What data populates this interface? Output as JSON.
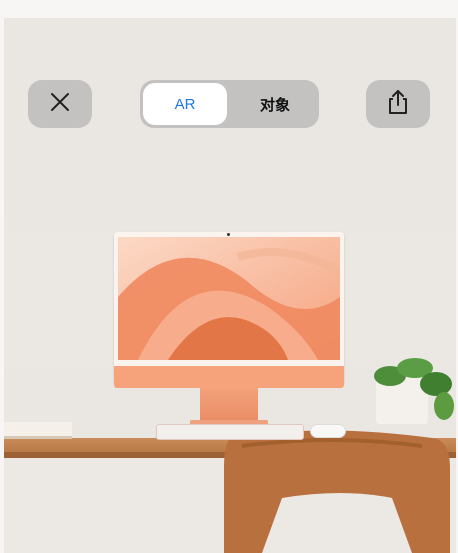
{
  "toolbar": {
    "close_icon": "close-icon",
    "share_icon": "share-icon",
    "tabs": [
      {
        "label": "AR",
        "selected": true
      },
      {
        "label": "对象",
        "selected": false
      }
    ]
  },
  "colors": {
    "accent": "#1f7ae0",
    "button_bg": "#b4b4b4"
  }
}
